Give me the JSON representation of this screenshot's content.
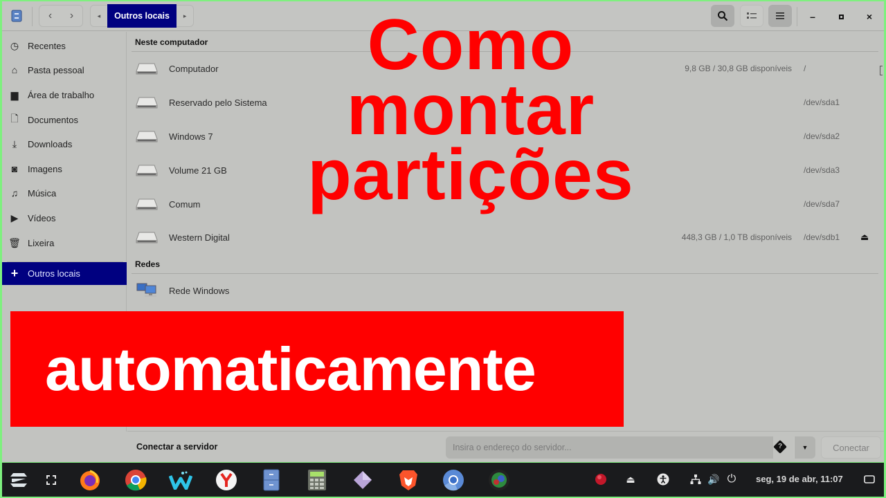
{
  "header": {
    "app_icon": "file-manager-icon",
    "back_label": "‹",
    "forward_label": "›",
    "path_left_arrow": "◂",
    "path_current": "Outros locais",
    "path_right_arrow": "▸",
    "search_icon": "search-icon",
    "view_icon": "list-view-icon",
    "menu_icon": "hamburger-menu-icon",
    "minimize": "–",
    "maximize": "▫",
    "close": "×"
  },
  "sidebar": {
    "items": [
      {
        "label": "Recentes",
        "icon": "◷"
      },
      {
        "label": "Pasta pessoal",
        "icon": "⌂"
      },
      {
        "label": "Área de trabalho",
        "icon": "▆"
      },
      {
        "label": "Documentos",
        "icon": "🗋"
      },
      {
        "label": "Downloads",
        "icon": "⤓"
      },
      {
        "label": "Imagens",
        "icon": "◙"
      },
      {
        "label": "Música",
        "icon": "♫"
      },
      {
        "label": "Vídeos",
        "icon": "▶"
      },
      {
        "label": "Lixeira",
        "icon": "🗑"
      }
    ],
    "other_locations": {
      "label": "Outros locais",
      "icon": "+"
    }
  },
  "main": {
    "section_computer": "Neste computador",
    "drives": [
      {
        "name": "Computador",
        "space": "9,8 GB / 30,8 GB disponíveis",
        "mount": "/",
        "eject": ""
      },
      {
        "name": "Reservado pelo Sistema",
        "space": "",
        "mount": "/dev/sda1",
        "eject": ""
      },
      {
        "name": "Windows 7",
        "space": "",
        "mount": "/dev/sda2",
        "eject": ""
      },
      {
        "name": "Volume 21 GB",
        "space": "",
        "mount": "/dev/sda3",
        "eject": ""
      },
      {
        "name": "Comum",
        "space": "",
        "mount": "/dev/sda7",
        "eject": ""
      },
      {
        "name": "Western Digital",
        "space": "448,3 GB / 1,0 TB disponíveis",
        "mount": "/dev/sdb1",
        "eject": "⏏"
      }
    ],
    "section_networks": "Redes",
    "networks": [
      {
        "name": "Rede Windows"
      }
    ]
  },
  "footer": {
    "label": "Conectar a servidor",
    "input_placeholder": "Insira o endereço do servidor...",
    "input_value": "",
    "help_glyph": "?",
    "dropdown_glyph": "▼",
    "connect_label": "Conectar"
  },
  "overlay": {
    "title_line1": "Como",
    "title_line2": "montar",
    "title_line3": "partições",
    "banner_text": "automaticamente",
    "title_color": "#ff0000",
    "banner_color": "#ff0000"
  },
  "taskbar": {
    "launchers": [
      {
        "name": "zorin-menu-icon"
      },
      {
        "name": "workspaces-icon"
      },
      {
        "name": "firefox-icon"
      },
      {
        "name": "chrome-icon"
      },
      {
        "name": "waterfox-icon"
      },
      {
        "name": "yandex-browser-icon"
      },
      {
        "name": "files-icon"
      },
      {
        "name": "calculator-icon"
      },
      {
        "name": "diamond-app-icon"
      },
      {
        "name": "brave-icon"
      },
      {
        "name": "chromium-icon"
      },
      {
        "name": "globe-app-icon"
      }
    ],
    "tray": {
      "record_icon": "record-icon",
      "eject_glyph": "⏏",
      "accessibility_icon": "accessibility-icon",
      "network_icon": "network-icon",
      "volume_glyph": "🔊",
      "power_glyph": "⏻",
      "clock": "seg, 19 de abr, 11:07",
      "show_desktop_icon": "show-desktop-icon"
    }
  }
}
